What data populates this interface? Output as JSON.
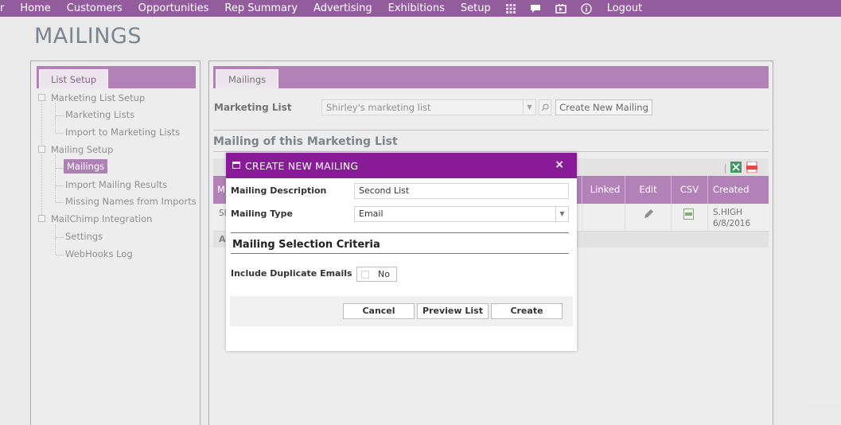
{
  "nav": {
    "items": [
      "Home",
      "Customers",
      "Opportunities",
      "Rep Summary",
      "Advertising",
      "Exhibitions",
      "Setup"
    ],
    "icons": [
      "grid-icon",
      "chat-icon",
      "video-icon",
      "info-icon"
    ],
    "logout": "Logout"
  },
  "page_title": "MAILINGS",
  "left_panel": {
    "tab": "List Setup",
    "tree": [
      {
        "label": "Marketing List Setup",
        "level": 0
      },
      {
        "label": "Marketing Lists",
        "level": 1
      },
      {
        "label": "Import to Marketing Lists",
        "level": 1
      },
      {
        "label": "Mailing Setup",
        "level": 0
      },
      {
        "label": "Mailings",
        "level": 1,
        "selected": true
      },
      {
        "label": "Import Mailing Results",
        "level": 1
      },
      {
        "label": "Missing Names from Imports",
        "level": 1
      },
      {
        "label": "MailChimp Integration",
        "level": 0
      },
      {
        "label": "Settings",
        "level": 1
      },
      {
        "label": "WebHooks Log",
        "level": 1
      }
    ]
  },
  "right_panel": {
    "tab": "Mailings",
    "marketing_list_label": "Marketing List",
    "marketing_list_value": "Shirley's marketing list",
    "create_new_mailing": "Create New Mailing",
    "section_title": "Mailing of this Marketing List",
    "grid": {
      "columns": [
        "M",
        "Linked",
        "Edit",
        "CSV",
        "Created"
      ],
      "row": {
        "first_cell": "Sl",
        "created_by": "S.HIGH",
        "created_date": "6/8/2016"
      },
      "footer_text": "A"
    }
  },
  "modal": {
    "title": "CREATE NEW MAILING",
    "close": "×",
    "description_label": "Mailing Description",
    "description_value": "Second List",
    "type_label": "Mailing Type",
    "type_value": "Email",
    "criteria_title": "Mailing Selection Criteria",
    "duplicate_label": "Include Duplicate Emails",
    "duplicate_value": "No",
    "buttons": {
      "cancel": "Cancel",
      "preview": "Preview List",
      "create": "Create"
    }
  },
  "colors": {
    "nav_bg": "#935d9d",
    "accent": "#a066a8",
    "modal_title_bg": "#8a1b98"
  }
}
